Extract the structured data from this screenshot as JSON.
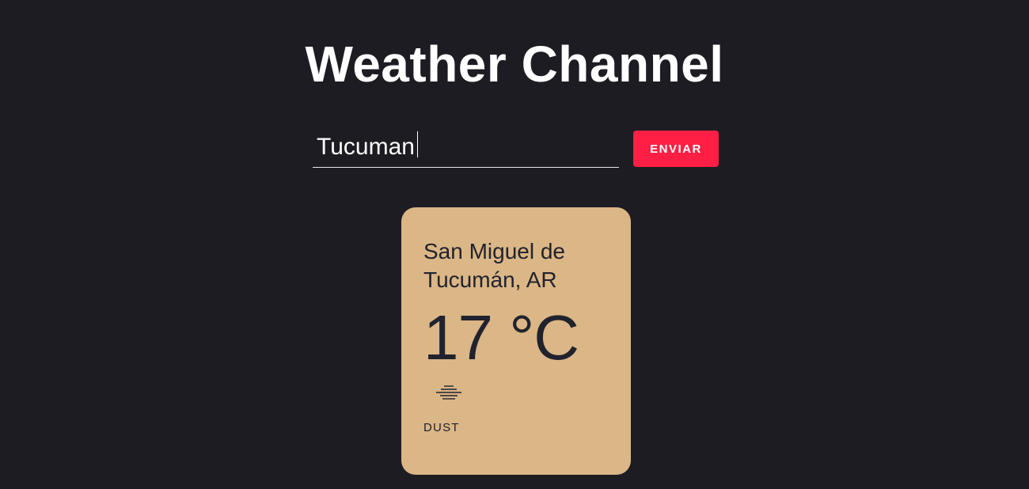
{
  "app": {
    "title": "Weather Channel"
  },
  "search": {
    "value": "Tucuman",
    "button_label": "ENVIAR"
  },
  "weather": {
    "location": "San Miguel de Tucumán, AR",
    "temperature": "17 °C",
    "condition": "DUST",
    "icon": "dust-haze-icon"
  },
  "colors": {
    "background": "#1d1c22",
    "accent": "#ff1f45",
    "card": "#dbb686",
    "text_dark": "#20232e",
    "text_light": "#ffffff"
  }
}
